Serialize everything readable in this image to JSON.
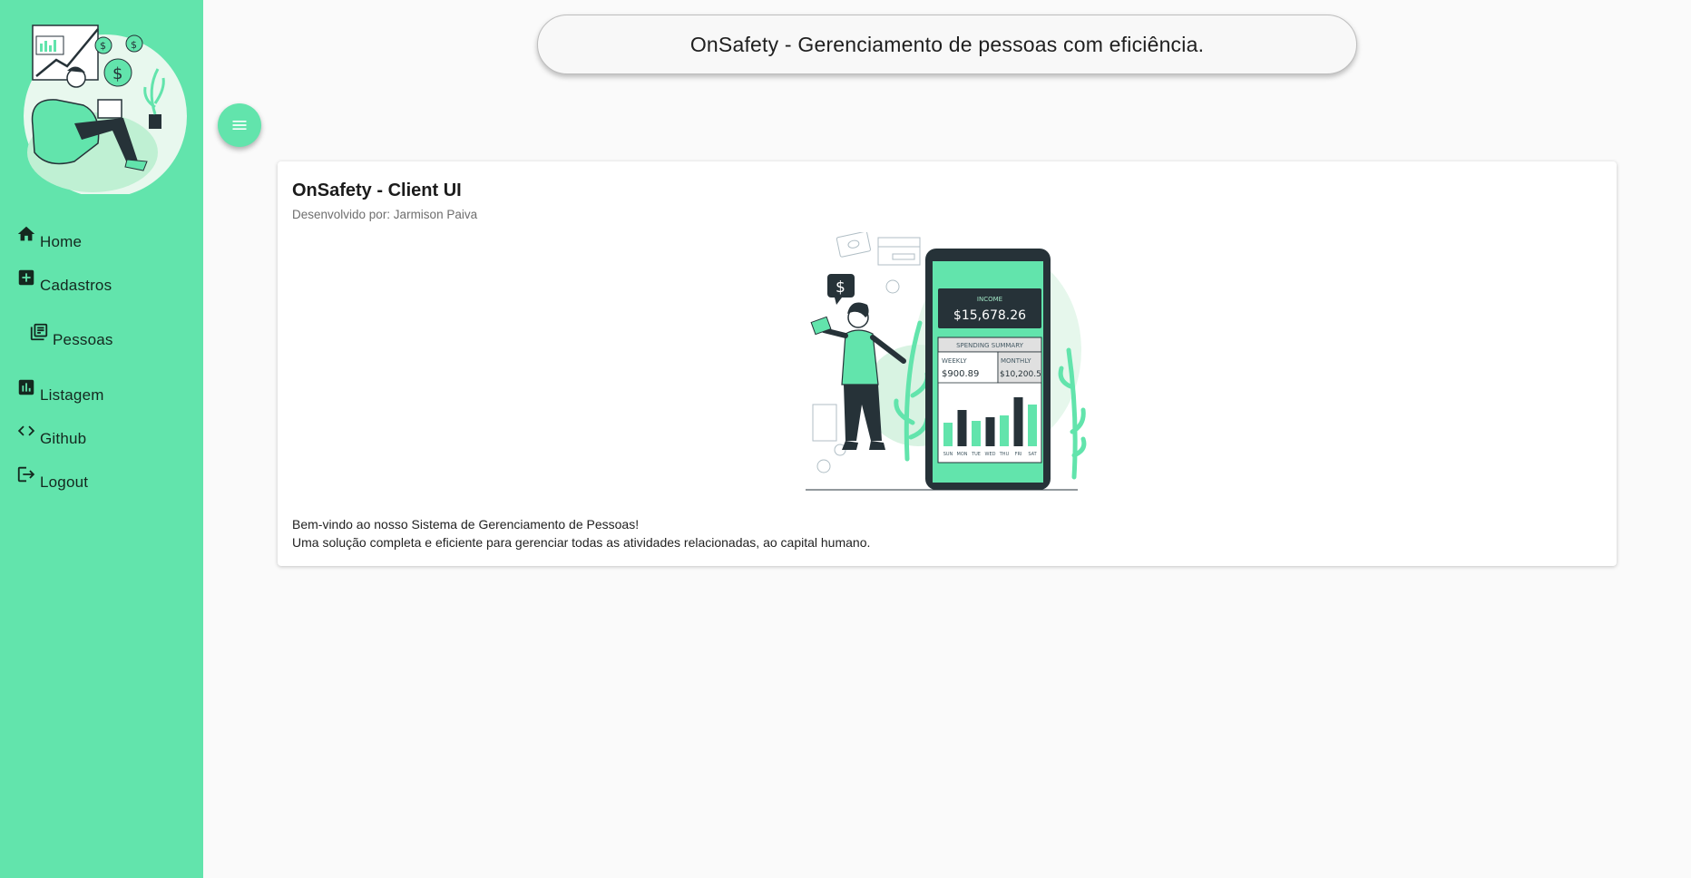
{
  "app": {
    "header_title": "OnSafety - Gerenciamento de pessoas com eficiência."
  },
  "sidebar": {
    "items": [
      {
        "label": "Home",
        "icon": "home-icon"
      },
      {
        "label": "Cadastros",
        "icon": "add-box-icon"
      },
      {
        "label": "Pessoas",
        "icon": "library-icon"
      },
      {
        "label": "Listagem",
        "icon": "bar-chart-icon"
      },
      {
        "label": "Github",
        "icon": "code-icon"
      },
      {
        "label": "Logout",
        "icon": "logout-icon"
      }
    ]
  },
  "card": {
    "title": "OnSafety - Client UI",
    "subtitle": "Desenvolvido por: Jarmison Paiva",
    "welcome_line1": "Bem-vindo ao nosso Sistema de Gerenciamento de Pessoas!",
    "welcome_line2": "Uma solução completa e eficiente para gerenciar todas as atividades relacionadas, ao capital humano."
  },
  "illustration": {
    "income_label": "INCOME",
    "income_value": "$15,678.26",
    "summary_label": "SPENDING SUMMARY",
    "weekly_label": "WEEKLY",
    "weekly_value": "$900.89",
    "monthly_label": "MONTHLY",
    "monthly_value": "$10,200.5",
    "days": [
      "SUN",
      "MON",
      "TUE",
      "WED",
      "THU",
      "FRI",
      "SAT"
    ],
    "dollar_sign": "$"
  },
  "colors": {
    "accent": "#62e4ac",
    "dark": "#263238",
    "background": "#fafafa"
  }
}
